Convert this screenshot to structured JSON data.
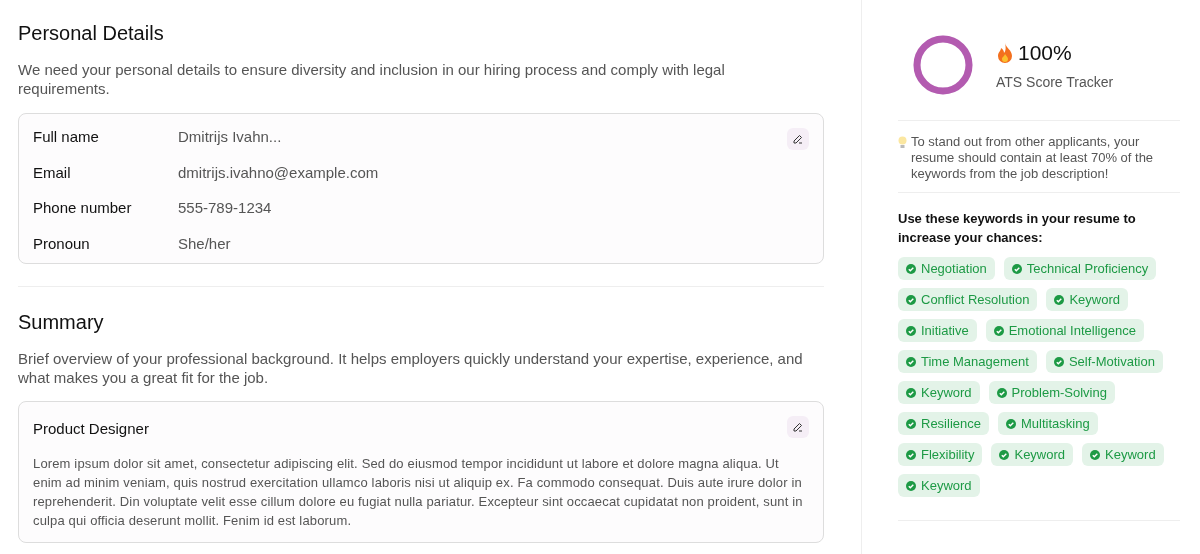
{
  "personal_details": {
    "title": "Personal Details",
    "description": "We need your personal details to ensure diversity and inclusion in our hiring process and comply with legal requirements.",
    "fields": [
      {
        "label": "Full name",
        "value": "Dmitrijs Ivahn..."
      },
      {
        "label": "Email",
        "value": "dmitrijs.ivahno@example.com"
      },
      {
        "label": "Phone number",
        "value": "555-789-1234"
      },
      {
        "label": "Pronoun",
        "value": "She/her"
      }
    ]
  },
  "summary": {
    "title": "Summary",
    "description": "Brief overview of your professional background. It helps employers quickly understand your expertise, experience, and what makes you a great fit for the job.",
    "card_title": "Product Designer",
    "card_text": "Lorem ipsum dolor sit amet, consectetur adipiscing elit. Sed do eiusmod tempor incididunt ut labore et dolore magna aliqua. Ut enim ad minim veniam, quis nostrud exercitation ullamco laboris nisi ut aliquip ex. Fa commodo consequat. Duis aute irure dolor in reprehenderit. Din voluptate velit esse cillum dolore eu fugiat nulla pariatur. Excepteur sint occaecat cupidatat non proident, sunt in culpa qui officia deserunt mollit. Fenim id est laborum."
  },
  "ats": {
    "level": 1,
    "score": "100%",
    "label": "ATS Score Tracker",
    "tip": "To stand out from other applicants, your resume should contain at least 70% of the keywords from the job description!",
    "keywords_title": "Use these keywords in your resume to increase your chances:",
    "keywords": [
      {
        "label": "Negotiation",
        "matched": true
      },
      {
        "label": "Technical Proficiency",
        "matched": true
      },
      {
        "label": "Conflict Resolution",
        "matched": true
      },
      {
        "label": "Keyword",
        "matched": true
      },
      {
        "label": "Initiative",
        "matched": true
      },
      {
        "label": "Emotional Intelligence",
        "matched": true
      },
      {
        "label": "Time Management",
        "matched": true
      },
      {
        "label": "Self-Motivation",
        "matched": true
      },
      {
        "label": "Keyword",
        "matched": true
      },
      {
        "label": "Problem-Solving",
        "matched": true
      },
      {
        "label": "Resilience",
        "matched": true
      },
      {
        "label": "Multitasking",
        "matched": true
      },
      {
        "label": "Flexibility",
        "matched": true
      },
      {
        "label": "Keyword",
        "matched": true
      },
      {
        "label": "Keyword",
        "matched": true
      },
      {
        "label": "Keyword",
        "matched": true
      }
    ]
  }
}
